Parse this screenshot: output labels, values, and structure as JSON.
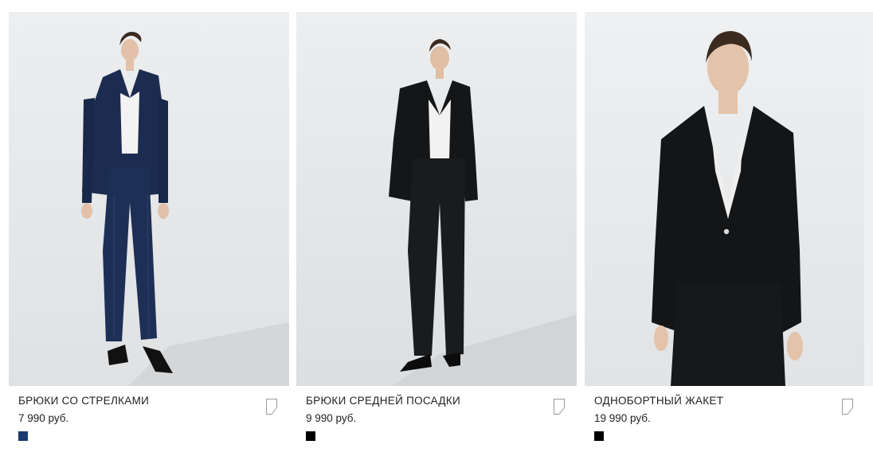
{
  "products": [
    {
      "title": "БРЮКИ СО СТРЕЛКАМИ",
      "price": "7 990 руб.",
      "swatch_color": "#1b3a6e",
      "image_icon": "navy-suit-photo",
      "favorite_icon": "bookmark-icon"
    },
    {
      "title": "БРЮКИ СРЕДНЕЙ ПОСАДКИ",
      "price": "9 990 руб.",
      "swatch_color": "#000000",
      "image_icon": "black-suit-photo",
      "favorite_icon": "bookmark-icon"
    },
    {
      "title": "ОДНОБОРТНЫЙ ЖАКЕТ",
      "price": "19 990 руб.",
      "swatch_color": "#000000",
      "image_icon": "black-jacket-photo",
      "favorite_icon": "bookmark-icon"
    }
  ]
}
